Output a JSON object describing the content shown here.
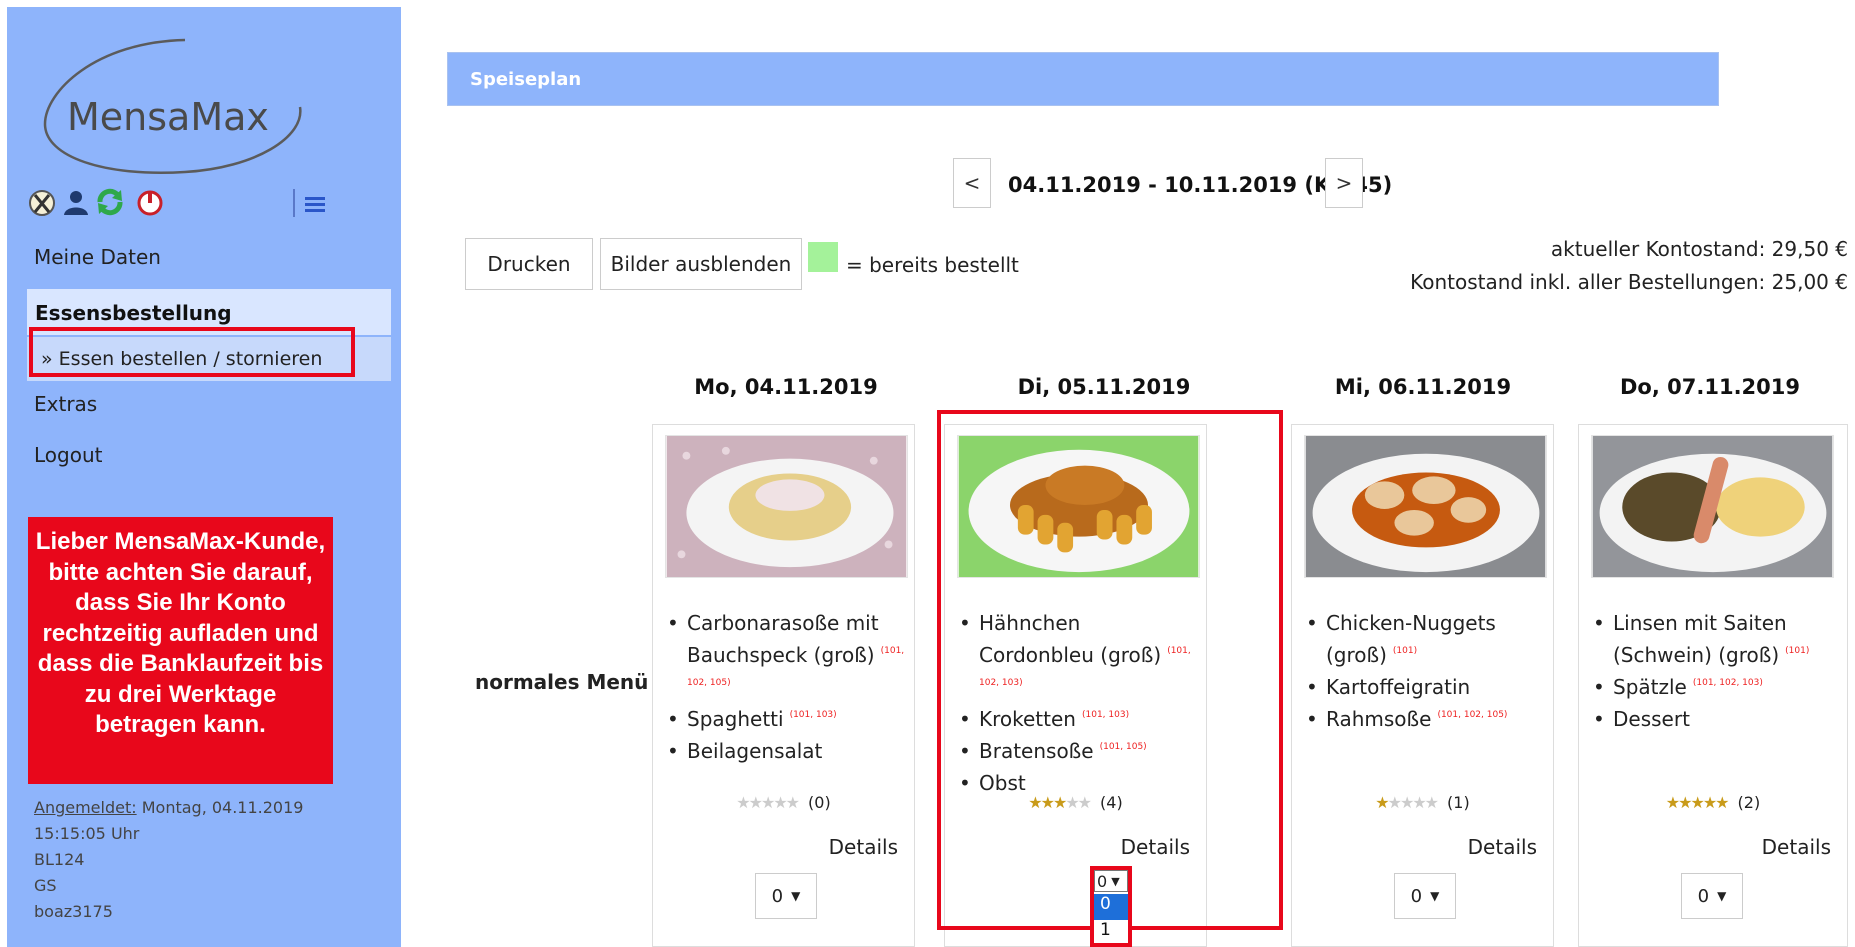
{
  "sidebar": {
    "logo_text": "MensaMax",
    "nav": {
      "meine_daten": "Meine Daten",
      "essensbestellung": "Essensbestellung",
      "essen_bestellen": "» Essen bestellen / stornieren",
      "extras": "Extras",
      "logout": "Logout"
    },
    "notice": "Lieber MensaMax-Kunde, bitte achten Sie darauf, dass Sie Ihr Konto rechtzeitig aufladen und dass die Banklaufzeit bis zu drei Werktage betragen kann.",
    "login": {
      "label": "Angemeldet:",
      "date": "Montag, 04.11.2019",
      "time": "15:15:05 Uhr",
      "line3": "BL124",
      "line4": "GS",
      "user": "boaz3175"
    },
    "icons": [
      "cutlery-icon",
      "user-icon",
      "refresh-icon",
      "power-icon",
      "menu-icon"
    ]
  },
  "main": {
    "title": "Speiseplan",
    "week": {
      "prev": "<",
      "label": "04.11.2019 - 10.11.2019 (KW45)",
      "next": ">"
    },
    "buttons": {
      "print": "Drucken",
      "hide_images": "Bilder ausblenden"
    },
    "legend": "= bereits bestellt",
    "balance": {
      "current": "aktueller Kontostand: 29,50 €",
      "incl": "Kontostand inkl. aller Bestellungen: 25,00 €"
    },
    "menu_label": "normales Menü",
    "details_label": "Details",
    "days": [
      {
        "date": "Mo, 04.11.2019",
        "items": [
          {
            "name": "Carbonarasoße mit Bauchspeck (groß)",
            "codes": "(101, 102, 105)"
          },
          {
            "name": "Spaghetti",
            "codes": "(101, 103)"
          },
          {
            "name": "Beilagensalat",
            "codes": ""
          }
        ],
        "stars": 0,
        "ratings": "(0)",
        "qty": "0"
      },
      {
        "date": "Di, 05.11.2019",
        "items": [
          {
            "name": "Hähnchen Cordonbleu (groß)",
            "codes": "(101, 102, 103)"
          },
          {
            "name": "Kroketten",
            "codes": "(101, 103)"
          },
          {
            "name": "Bratensoße",
            "codes": "(101, 105)"
          },
          {
            "name": "Obst",
            "codes": ""
          }
        ],
        "stars": 3,
        "ratings": "(4)",
        "qty": "0"
      },
      {
        "date": "Mi, 06.11.2019",
        "items": [
          {
            "name": "Chicken-Nuggets (groß)",
            "codes": "(101)"
          },
          {
            "name": "Kartoffeigratin",
            "codes": ""
          },
          {
            "name": "Rahmsoße",
            "codes": "(101, 102, 105)"
          }
        ],
        "stars": 1,
        "ratings": "(1)",
        "qty": "0"
      },
      {
        "date": "Do, 07.11.2019",
        "items": [
          {
            "name": "Linsen mit Saiten (Schwein) (groß)",
            "codes": "(101)"
          },
          {
            "name": "Spätzle",
            "codes": "(101, 102, 103)"
          },
          {
            "name": "Dessert",
            "codes": ""
          }
        ],
        "stars": 5,
        "ratings": "(2)",
        "qty": "0"
      }
    ],
    "dropdown_open": {
      "selected": "0",
      "options": [
        "0",
        "1"
      ]
    }
  },
  "colors": {
    "sidebar_bg": "#8eb4fb",
    "highlight_red": "#e8071b",
    "ordered_green": "#a4f29a",
    "select_blue": "#1e6fd9"
  }
}
